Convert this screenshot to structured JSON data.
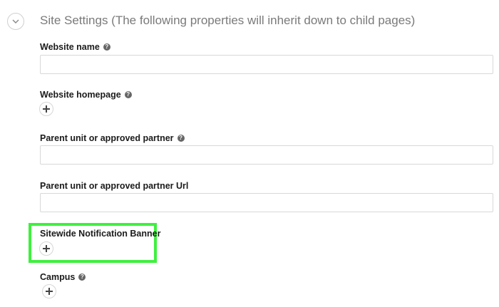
{
  "section": {
    "title": "Site Settings (The following properties will inherit down to child pages)",
    "toggle_icon": "chevron-down-icon"
  },
  "fields": {
    "website_name": {
      "label": "Website name",
      "value": "",
      "has_help": true
    },
    "website_homepage": {
      "label": "Website homepage",
      "has_help": true,
      "add_icon": "plus-icon"
    },
    "parent_unit": {
      "label": "Parent unit or approved partner",
      "value": "",
      "has_help": true
    },
    "parent_unit_url": {
      "label": "Parent unit or approved partner Url",
      "value": "",
      "has_help": false
    },
    "notification_banner": {
      "label": "Sitewide Notification Banner",
      "has_help": false,
      "add_icon": "plus-icon",
      "highlighted": true
    },
    "campus": {
      "label": "Campus",
      "has_help": true,
      "add_icon": "plus-icon"
    }
  },
  "icons": {
    "help": "question-circle-icon"
  },
  "colors": {
    "highlight": "#3ef03e",
    "title_text": "#7a7a7a",
    "input_border": "#d8d8d8"
  }
}
